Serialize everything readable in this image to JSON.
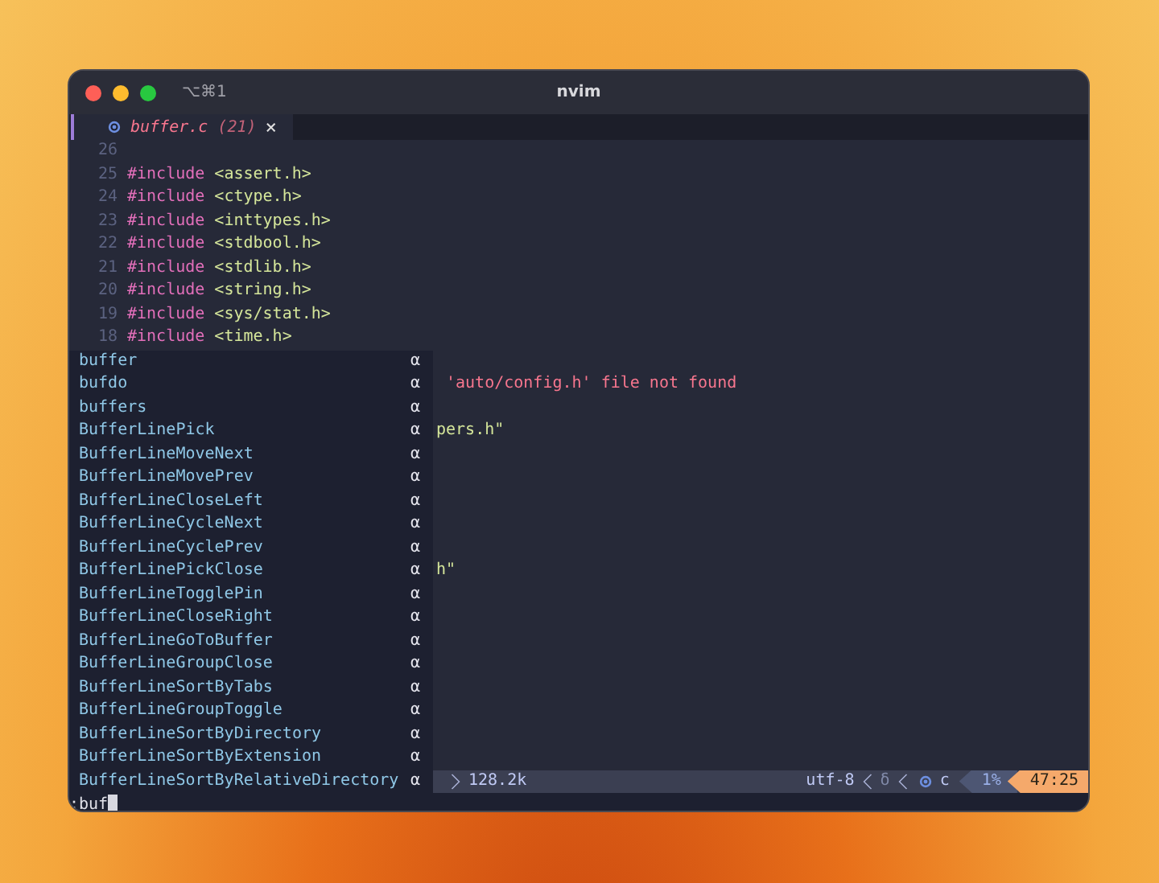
{
  "window": {
    "shortcut": "⌥⌘1",
    "title": "nvim"
  },
  "tab": {
    "name": "buffer.c",
    "count": "(21)",
    "close": "×"
  },
  "code_lines": [
    {
      "number": "26"
    },
    {
      "number": "25",
      "directive": "#include",
      "header": "<assert.h>"
    },
    {
      "number": "24",
      "directive": "#include",
      "header": "<ctype.h>"
    },
    {
      "number": "23",
      "directive": "#include",
      "header": "<inttypes.h>"
    },
    {
      "number": "22",
      "directive": "#include",
      "header": "<stdbool.h>"
    },
    {
      "number": "21",
      "directive": "#include",
      "header": "<stdlib.h>"
    },
    {
      "number": "20",
      "directive": "#include",
      "header": "<string.h>"
    },
    {
      "number": "19",
      "directive": "#include",
      "header": "<sys/stat.h>"
    },
    {
      "number": "18",
      "directive": "#include",
      "header": "<time.h>"
    }
  ],
  "covered_rows": [
    {
      "kind": "blank"
    },
    {
      "kind": "error",
      "text": "'auto/config.h' file not found"
    },
    {
      "kind": "blank"
    },
    {
      "kind": "string",
      "text": "pers.h\""
    },
    {
      "kind": "blank"
    },
    {
      "kind": "blank"
    },
    {
      "kind": "blank"
    },
    {
      "kind": "blank"
    },
    {
      "kind": "blank"
    },
    {
      "kind": "string",
      "text": "h\""
    },
    {
      "kind": "blank"
    },
    {
      "kind": "blank"
    },
    {
      "kind": "blank"
    },
    {
      "kind": "blank"
    },
    {
      "kind": "blank"
    },
    {
      "kind": "blank"
    },
    {
      "kind": "blank"
    },
    {
      "kind": "blank"
    }
  ],
  "completion_menu": [
    {
      "label": "buffer",
      "tag": "α",
      "selected": false
    },
    {
      "label": "bufdo",
      "tag": "α",
      "selected": false
    },
    {
      "label": "buffers",
      "tag": "α",
      "selected": false
    },
    {
      "label": "BufferLinePick",
      "tag": "α",
      "selected": false
    },
    {
      "label": "BufferLineMoveNext",
      "tag": "α",
      "selected": false
    },
    {
      "label": "BufferLineMovePrev",
      "tag": "α",
      "selected": false
    },
    {
      "label": "BufferLineCloseLeft",
      "tag": "α",
      "selected": false
    },
    {
      "label": "BufferLineCycleNext",
      "tag": "α",
      "selected": false
    },
    {
      "label": "BufferLineCyclePrev",
      "tag": "α",
      "selected": false
    },
    {
      "label": "BufferLinePickClose",
      "tag": "α",
      "selected": false
    },
    {
      "label": "BufferLineTogglePin",
      "tag": "α",
      "selected": false
    },
    {
      "label": "BufferLineCloseRight",
      "tag": "α",
      "selected": false
    },
    {
      "label": "BufferLineGoToBuffer",
      "tag": "α",
      "selected": false
    },
    {
      "label": "BufferLineGroupClose",
      "tag": "α",
      "selected": false
    },
    {
      "label": "BufferLineSortByTabs",
      "tag": "α",
      "selected": false
    },
    {
      "label": "BufferLineGroupToggle",
      "tag": "α",
      "selected": false
    },
    {
      "label": "BufferLineSortByDirectory",
      "tag": "α",
      "selected": false
    },
    {
      "label": "BufferLineSortByExtension",
      "tag": "α",
      "selected": false
    },
    {
      "label": "BufferLineSortByRelativeDirectory",
      "tag": "α",
      "selected": false
    }
  ],
  "status_line": {
    "file_size": "128.2k",
    "encoding": "utf-8",
    "format_glyph": "δ",
    "filetype": "c",
    "progress": "1%",
    "position": "47:25"
  },
  "command_line": {
    "value": ":buf"
  }
}
